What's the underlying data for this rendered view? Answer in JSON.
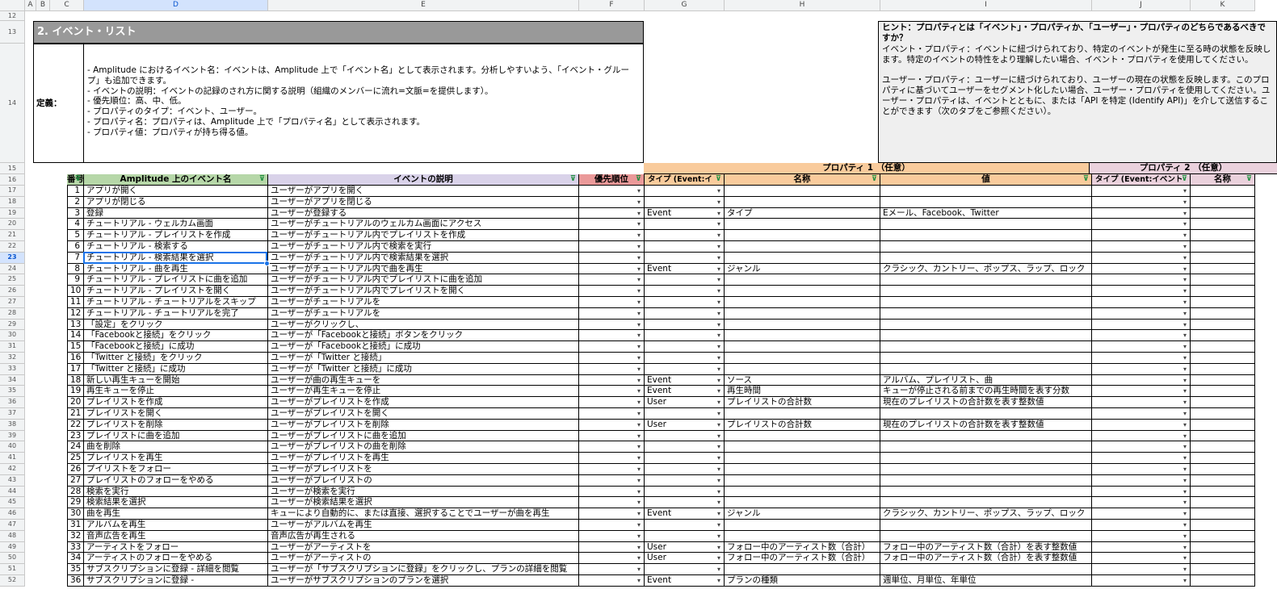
{
  "columns": [
    {
      "id": "A",
      "w": 14
    },
    {
      "id": "B",
      "w": 17
    },
    {
      "id": "C",
      "w": 42
    },
    {
      "id": "D",
      "w": 228
    },
    {
      "id": "E",
      "w": 385
    },
    {
      "id": "F",
      "w": 81
    },
    {
      "id": "G",
      "w": 99
    },
    {
      "id": "H",
      "w": 193
    },
    {
      "id": "I",
      "w": 262
    },
    {
      "id": "J",
      "w": 122
    },
    {
      "id": "K",
      "w": 80
    }
  ],
  "selected_column": "D",
  "selected_row": "23",
  "section": {
    "title": "2. イベント・リスト",
    "definition_label": "定義：",
    "definition_text": "- Amplitude におけるイベント名：イベントは、Amplitude 上で「イベント名」として表示されます。分析しやすいよう、「イベント・グループ」も追加できます。\n- イベントの説明：イベントの記録のされ方に関する説明（組織のメンバーに流れ=文脈=を提供します）。\n- 優先順位：高、中、低。\n- プロパティのタイプ：イベント、ユーザー。\n- プロパティ名：プロパティは、Amplitude 上で「プロパティ名」として表示されます。\n- プロパティ値：プロパティが持ち得る値。"
  },
  "hint": {
    "title": "ヒント：プロパティとは「イベント」・プロパティか、「ユーザー」・プロパティのどちらであるべきですか？",
    "body": "イベント・プロパティ：イベントに紐づけられており、特定のイベントが発生に至る時の状態を反映します。特定のイベントの特性をより理解したい場合、イベント・プロパティを使用してください。\n\nユーザー・プロパティ：ユーザーに紐づけられており、ユーザーの現在の状態を反映します。このプロパティに基づいてユーザーをセグメント化したい場合、ユーザー・プロパティを使用してください。ユーザー・プロパティは、イベントとともに、または「API を特定 (Identify API)」を介して送信することができます（次のタブをご参照ください）。"
  },
  "group_headers": {
    "prop1": "プロパティ 1 （任意）",
    "prop2": "プロパティ 2 （任意）"
  },
  "headers": {
    "num": "番号",
    "event_name": "Amplitude 上のイベント名",
    "description": "イベントの説明",
    "priority": "優先順位",
    "type1": "タイプ (Event:イ",
    "name1": "名称",
    "value1": "値",
    "type2": "タイプ (Event:イベント",
    "name2": "名称"
  },
  "rows": [
    {
      "r": "17",
      "n": "1",
      "ev": "アプリが開く",
      "desc": "ユーザーがアプリを開く",
      "type": "",
      "name": "",
      "val": ""
    },
    {
      "r": "18",
      "n": "2",
      "ev": "アプリが閉じる",
      "desc": "ユーザーがアプリを閉じる",
      "type": "",
      "name": "",
      "val": ""
    },
    {
      "r": "19",
      "n": "3",
      "ev": "登録",
      "desc": "ユーザーが登録する",
      "type": "Event",
      "name": "タイプ",
      "val": "Eメール、Facebook、Twitter"
    },
    {
      "r": "20",
      "n": "4",
      "ev": "チュートリアル - ウェルカム画面",
      "desc": "ユーザーがチュートリアルのウェルカム画面にアクセス",
      "type": "",
      "name": "",
      "val": ""
    },
    {
      "r": "21",
      "n": "5",
      "ev": "チュートリアル - プレイリストを作成",
      "desc": "ユーザーがチュートリアル内でプレイリストを作成",
      "type": "",
      "name": "",
      "val": ""
    },
    {
      "r": "22",
      "n": "6",
      "ev": "チュートリアル - 検索する",
      "desc": "ユーザーがチュートリアル内で検索を実行",
      "type": "",
      "name": "",
      "val": ""
    },
    {
      "r": "23",
      "n": "7",
      "ev": "チュートリアル - 検索結果を選択",
      "desc": "ユーザーがチュートリアル内で検索結果を選択",
      "type": "",
      "name": "",
      "val": ""
    },
    {
      "r": "24",
      "n": "8",
      "ev": "チュートリアル - 曲を再生",
      "desc": "ユーザーがチュートリアル内で曲を再生",
      "type": "Event",
      "name": "ジャンル",
      "val": "クラシック、カントリー、ポップス、ラップ、ロック"
    },
    {
      "r": "25",
      "n": "9",
      "ev": "チュートリアル - プレイリストに曲を追加",
      "desc": "ユーザーがチュートリアル内でプレイリストに曲を追加",
      "type": "",
      "name": "",
      "val": ""
    },
    {
      "r": "26",
      "n": "10",
      "ev": "チュートリアル - プレイリストを開く",
      "desc": "ユーザーがチュートリアル内でプレイリストを開く",
      "type": "",
      "name": "",
      "val": ""
    },
    {
      "r": "27",
      "n": "11",
      "ev": "チュートリアル - チュートリアルをスキップ",
      "desc": "ユーザーがチュートリアルを",
      "type": "",
      "name": "",
      "val": ""
    },
    {
      "r": "28",
      "n": "12",
      "ev": "チュートリアル - チュートリアルを完了",
      "desc": "ユーザーがチュートリアルを",
      "type": "",
      "name": "",
      "val": ""
    },
    {
      "r": "29",
      "n": "13",
      "ev": "「設定」をクリック",
      "desc": "ユーザーがクリックし、",
      "type": "",
      "name": "",
      "val": ""
    },
    {
      "r": "30",
      "n": "14",
      "ev": "「Facebookと接続」をクリック",
      "desc": "ユーザーが「Facebookと接続」ボタンをクリック",
      "type": "",
      "name": "",
      "val": ""
    },
    {
      "r": "31",
      "n": "15",
      "ev": "「Facebookと接続」に成功",
      "desc": "ユーザーが「Facebookと接続」に成功",
      "type": "",
      "name": "",
      "val": ""
    },
    {
      "r": "32",
      "n": "16",
      "ev": "「Twitter と接続」をクリック",
      "desc": "ユーザーが「Twitter と接続」",
      "type": "",
      "name": "",
      "val": ""
    },
    {
      "r": "33",
      "n": "17",
      "ev": "「Twitter と接続」に成功",
      "desc": "ユーザーが「Twitter と接続」に成功",
      "type": "",
      "name": "",
      "val": ""
    },
    {
      "r": "34",
      "n": "18",
      "ev": "新しい再生キューを開始",
      "desc": "ユーザーが曲の再生キューを",
      "type": "Event",
      "name": "ソース",
      "val": "アルバム、プレイリスト、曲"
    },
    {
      "r": "35",
      "n": "19",
      "ev": "再生キューを停止",
      "desc": "ユーザーが再生キューを停止",
      "type": "Event",
      "name": "再生時間",
      "val": "キューが停止される前までの再生時間を表す分数"
    },
    {
      "r": "36",
      "n": "20",
      "ev": "プレイリストを作成",
      "desc": "ユーザーがプレイリストを作成",
      "type": "User",
      "name": "プレイリストの合計数",
      "val": "現在のプレイリストの合計数を表す整数値"
    },
    {
      "r": "37",
      "n": "21",
      "ev": "プレイリストを開く",
      "desc": "ユーザーがプレイリストを開く",
      "type": "",
      "name": "",
      "val": ""
    },
    {
      "r": "38",
      "n": "22",
      "ev": "プレイリストを削除",
      "desc": "ユーザーがプレイリストを削除",
      "type": "User",
      "name": "プレイリストの合計数",
      "val": "現在のプレイリストの合計数を表す整数値"
    },
    {
      "r": "39",
      "n": "23",
      "ev": "プレイリストに曲を追加",
      "desc": "ユーザーがプレイリストに曲を追加",
      "type": "",
      "name": "",
      "val": ""
    },
    {
      "r": "40",
      "n": "24",
      "ev": "曲を削除",
      "desc": "ユーザーがプレイリストの曲を削除",
      "type": "",
      "name": "",
      "val": ""
    },
    {
      "r": "41",
      "n": "25",
      "ev": "プレイリストを再生",
      "desc": "ユーザーがプレイリストを再生",
      "type": "",
      "name": "",
      "val": ""
    },
    {
      "r": "42",
      "n": "26",
      "ev": "プイリストをフォロー",
      "desc": "ユーザーがプレイリストを",
      "type": "",
      "name": "",
      "val": ""
    },
    {
      "r": "43",
      "n": "27",
      "ev": "プレイリストのフォローをやめる",
      "desc": "ユーザーがプレイリストの",
      "type": "",
      "name": "",
      "val": ""
    },
    {
      "r": "44",
      "n": "28",
      "ev": "検索を実行",
      "desc": "ユーザーが検索を実行",
      "type": "",
      "name": "",
      "val": ""
    },
    {
      "r": "45",
      "n": "29",
      "ev": "検索結果を選択",
      "desc": "ユーザーが検索結果を選択",
      "type": "",
      "name": "",
      "val": ""
    },
    {
      "r": "46",
      "n": "30",
      "ev": "曲を再生",
      "desc": "キューにより自動的に、または直接、選択することでユーザーが曲を再生",
      "type": "Event",
      "name": "ジャンル",
      "val": "クラシック、カントリー、ポップス、ラップ、ロック"
    },
    {
      "r": "47",
      "n": "31",
      "ev": "アルバムを再生",
      "desc": "ユーザーがアルバムを再生",
      "type": "",
      "name": "",
      "val": ""
    },
    {
      "r": "48",
      "n": "32",
      "ev": "音声広告を再生",
      "desc": "音声広告が再生される",
      "type": "",
      "name": "",
      "val": ""
    },
    {
      "r": "49",
      "n": "33",
      "ev": "アーティストをフォロー",
      "desc": "ユーザーがアーティストを",
      "type": "User",
      "name": "フォロー中のアーティスト数（合計）",
      "val": "フォロー中のアーティスト数（合計）を表す整数値"
    },
    {
      "r": "50",
      "n": "34",
      "ev": "アーティストのフォローをやめる",
      "desc": "ユーザーがアーティストの",
      "type": "User",
      "name": "フォロー中のアーティスト数（合計）",
      "val": "フォロー中のアーティスト数（合計）を表す整数値"
    },
    {
      "r": "51",
      "n": "35",
      "ev": "サブスクリプションに登録 - 詳細を閲覧",
      "desc": "ユーザーが「サブスクリプションに登録」をクリックし、プランの詳細を閲覧",
      "type": "",
      "name": "",
      "val": ""
    },
    {
      "r": "52",
      "n": "36",
      "ev": "サブスクリプションに登録 -",
      "desc": "ユーザーがサブスクリプションのプランを選択",
      "type": "Event",
      "name": "プランの種類",
      "val": "週単位、月単位、年単位"
    }
  ],
  "colors": {
    "header_green": "#b6d7a8",
    "header_purple": "#d9d2e9",
    "header_red": "#ea9999",
    "header_orange": "#f9cb9c",
    "header_pink": "#ead1dc",
    "section_gray": "#999999",
    "hint_gray": "#efefef"
  }
}
